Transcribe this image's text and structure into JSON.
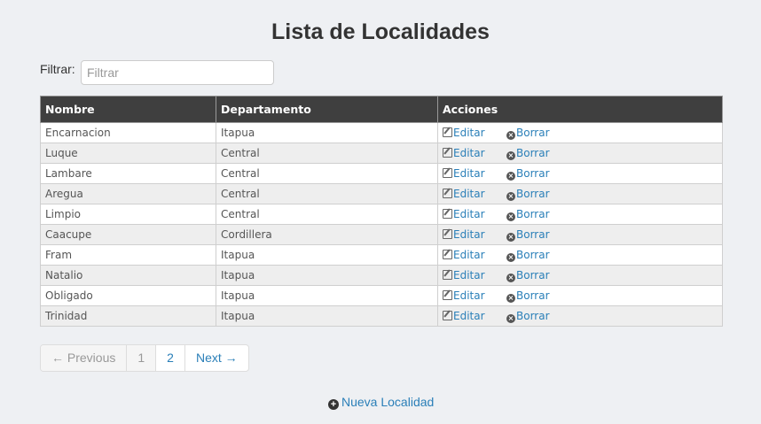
{
  "page": {
    "title": "Lista de Localidades"
  },
  "filter": {
    "label": "Filtrar:",
    "placeholder": "Filtrar",
    "value": ""
  },
  "table": {
    "headers": [
      "Nombre",
      "Departamento",
      "Acciones"
    ],
    "edit_label": "Editar",
    "delete_label": "Borrar",
    "rows": [
      {
        "nombre": "Encarnacion",
        "departamento": "Itapua"
      },
      {
        "nombre": "Luque",
        "departamento": "Central"
      },
      {
        "nombre": "Lambare",
        "departamento": "Central"
      },
      {
        "nombre": "Aregua",
        "departamento": "Central"
      },
      {
        "nombre": "Limpio",
        "departamento": "Central"
      },
      {
        "nombre": "Caacupe",
        "departamento": "Cordillera"
      },
      {
        "nombre": "Fram",
        "departamento": "Itapua"
      },
      {
        "nombre": "Natalio",
        "departamento": "Itapua"
      },
      {
        "nombre": "Obligado",
        "departamento": "Itapua"
      },
      {
        "nombre": "Trinidad",
        "departamento": "Itapua"
      }
    ]
  },
  "pagination": {
    "previous": "← Previous",
    "pages": [
      "1",
      "2"
    ],
    "current_page": "1",
    "next": "Next →"
  },
  "actions": {
    "new_label": "Nueva Localidad"
  },
  "colors": {
    "header_bg": "#3f3f3f",
    "link": "#2a7fb8",
    "page_bg": "#eef0f3"
  }
}
